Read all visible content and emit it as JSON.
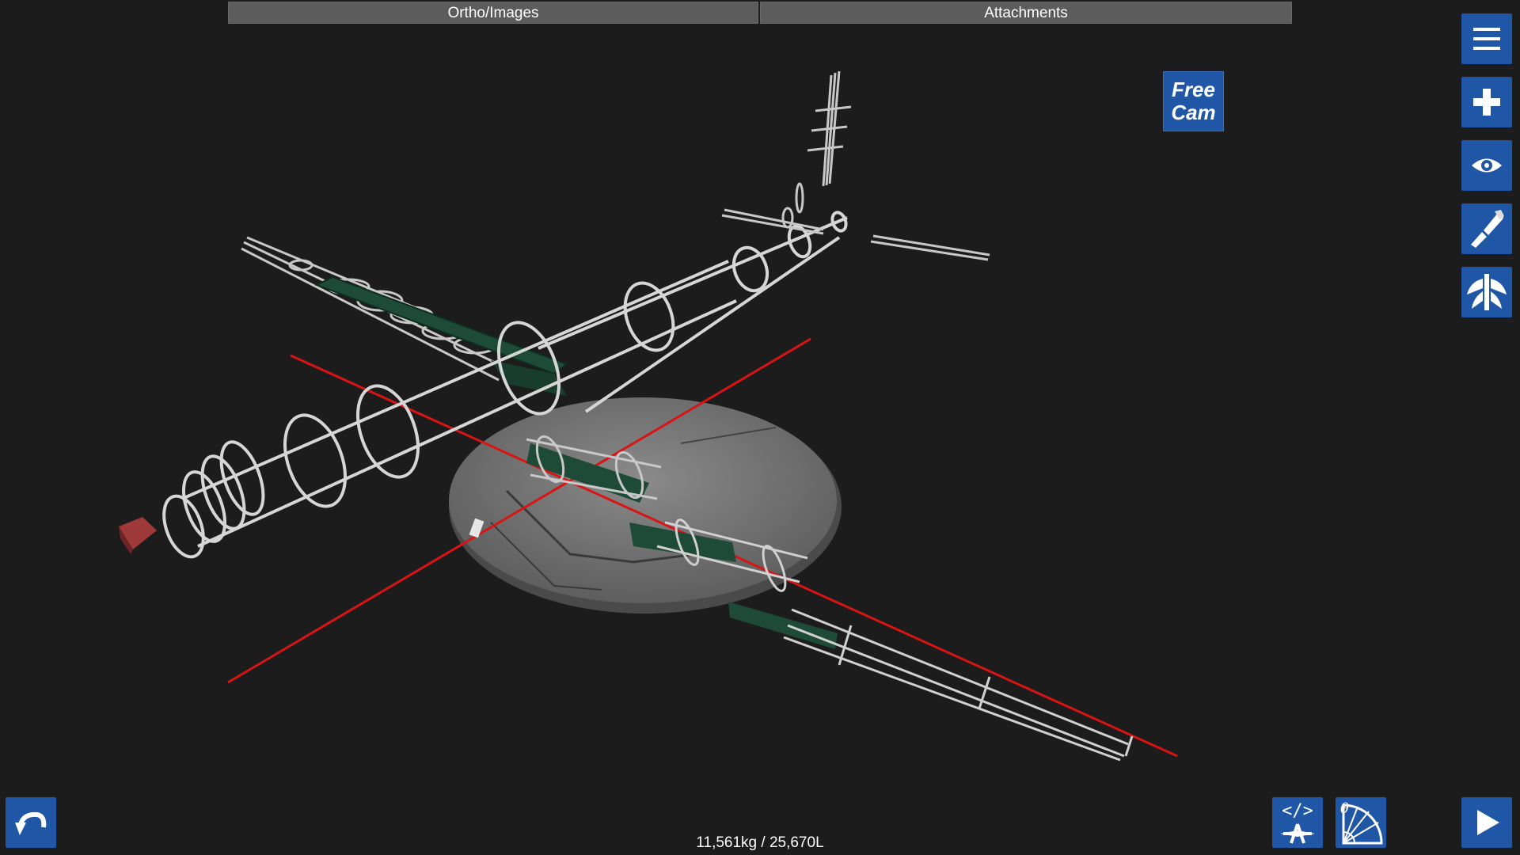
{
  "tabs": {
    "ortho_label": "Ortho/Images",
    "attachments_label": "Attachments"
  },
  "camera": {
    "free_cam_line1": "Free",
    "free_cam_line2": "Cam"
  },
  "status": {
    "mass_fuel": "11,561kg / 25,670L"
  },
  "icons": {
    "menu": "hamburger-menu-icon",
    "add_part": "plus-icon",
    "view": "eye-icon",
    "paint": "paintbrush-icon",
    "symmetry": "symmetry-wings-icon",
    "undo": "undo-arrow-icon",
    "xml_edit": "xml-airplane-icon",
    "rotation": "rotation-angle-icon",
    "play": "play-icon"
  },
  "colors": {
    "button_blue": "#1f56a6",
    "background": "#1c1c1c",
    "axis_red": "#d81414",
    "tank_green": "#1e4a38"
  }
}
